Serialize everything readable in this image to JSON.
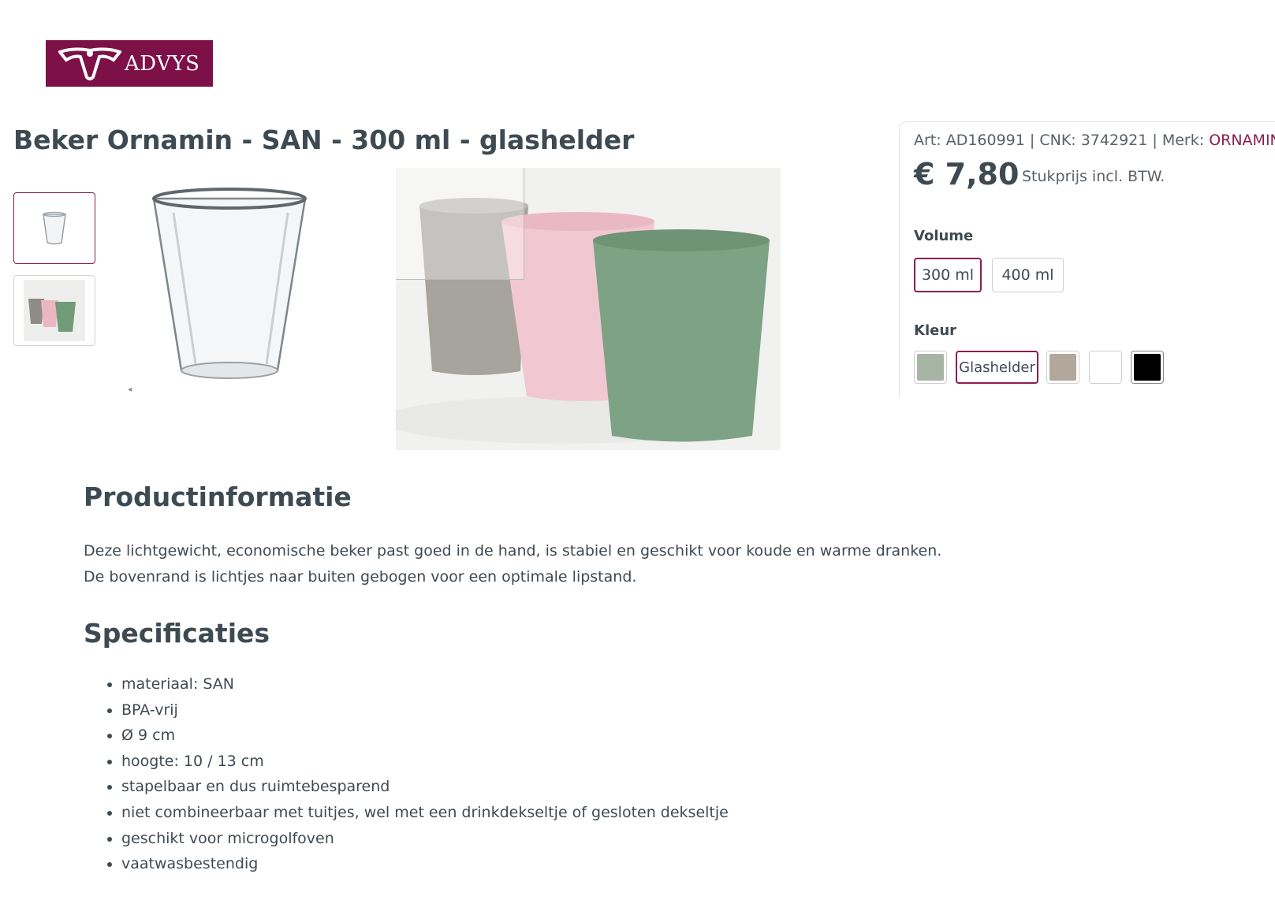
{
  "brand": {
    "logo_text": "ADVYS"
  },
  "product": {
    "title": "Beker Ornamin - SAN - 300 ml - glashelder",
    "meta": {
      "art": "Art: AD160991",
      "cnk": "CNK: 3742921",
      "merk_label": "Merk:",
      "merk": "ORNAMIN"
    },
    "price": "€ 7,80",
    "price_note": "Stukprijs incl. BTW."
  },
  "options": {
    "volume_label": "Volume",
    "volumes": [
      "300 ml",
      "400 ml"
    ],
    "selected_volume": "300 ml",
    "color_label": "Kleur",
    "colors": [
      {
        "hex": "#a7b6a4"
      },
      {
        "label": "Glashelder"
      },
      {
        "hex": "#b3a79c"
      },
      {
        "hex": "#ffffff"
      },
      {
        "hex": "#000000"
      }
    ],
    "selected_color": "Glashelder"
  },
  "info": {
    "heading": "Productinformatie",
    "lines": [
      "Deze lichtgewicht, economische beker past goed in de hand, is stabiel en geschikt voor koude en warme dranken.",
      "De bovenrand is lichtjes naar buiten gebogen voor een optimale lipstand."
    ]
  },
  "specs": {
    "heading": "Specificaties",
    "items": [
      "materiaal: SAN",
      "BPA-vrij",
      "Ø 9 cm",
      "hoogte: 10 / 13 cm",
      "stapelbaar en dus ruimtebesparend",
      "niet combineerbaar met tuitjes, wel met een drinkdekseltje of gesloten dekseltje",
      "geschikt voor microgolfoven",
      "vaatwasbestendig"
    ]
  },
  "colors": {
    "accent": "#8b1e4e",
    "logo_bg": "#7c1047",
    "text": "#3e4a52"
  }
}
